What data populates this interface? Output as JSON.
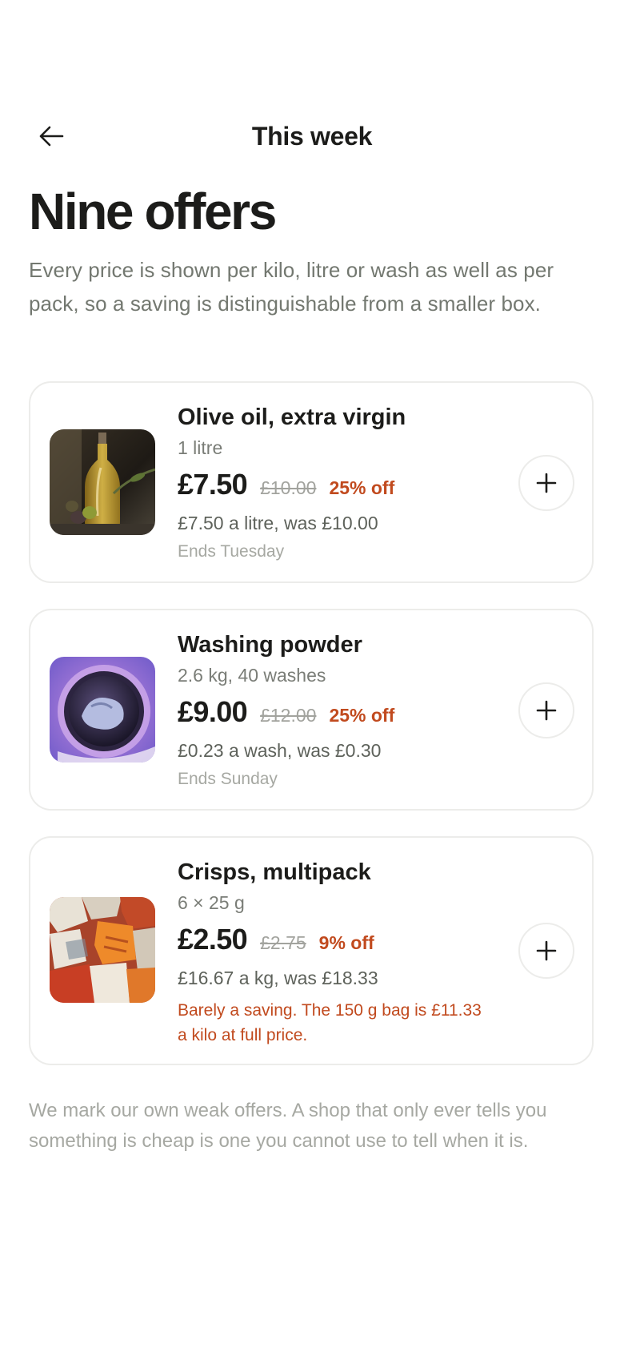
{
  "header": {
    "back_icon": "arrow-left-icon",
    "title": "This week"
  },
  "page": {
    "title": "Nine offers",
    "intro": "Every price is shown per kilo, litre or wash as well as per pack, so a saving is distinguishable from a smaller box."
  },
  "offers": [
    {
      "name": "Olive oil, extra virgin",
      "size": "1 litre",
      "price": "£7.50",
      "was": "£10.00",
      "discount": "25% off",
      "unit_price": "£7.50 a litre, was £10.00",
      "ends": "Ends Tuesday",
      "image": "olive-oil-bottle-photo"
    },
    {
      "name": "Washing powder",
      "size": "2.6 kg, 40 washes",
      "price": "£9.00",
      "was": "£12.00",
      "discount": "25% off",
      "unit_price": "£0.23 a wash, was £0.30",
      "ends": "Ends Sunday",
      "image": "washing-machine-drum-photo"
    },
    {
      "name": "Crisps, multipack",
      "size": "6 × 25 g",
      "price": "£2.50",
      "was": "£2.75",
      "discount": "9% off",
      "unit_price": "£16.67 a kg, was £18.33",
      "warning": "Barely a saving. The 150 g bag is £11.33 a kilo at full price.",
      "image": "crisp-packets-photo"
    }
  ],
  "add_icon": "plus-icon",
  "footer_note": "We mark our own weak offers. A shop that only ever tells you something is cheap is one you cannot use to tell when it is.",
  "colors": {
    "text": "#1c1c1a",
    "muted": "#737870",
    "accent": "#c14a1e",
    "border": "#ececea"
  }
}
